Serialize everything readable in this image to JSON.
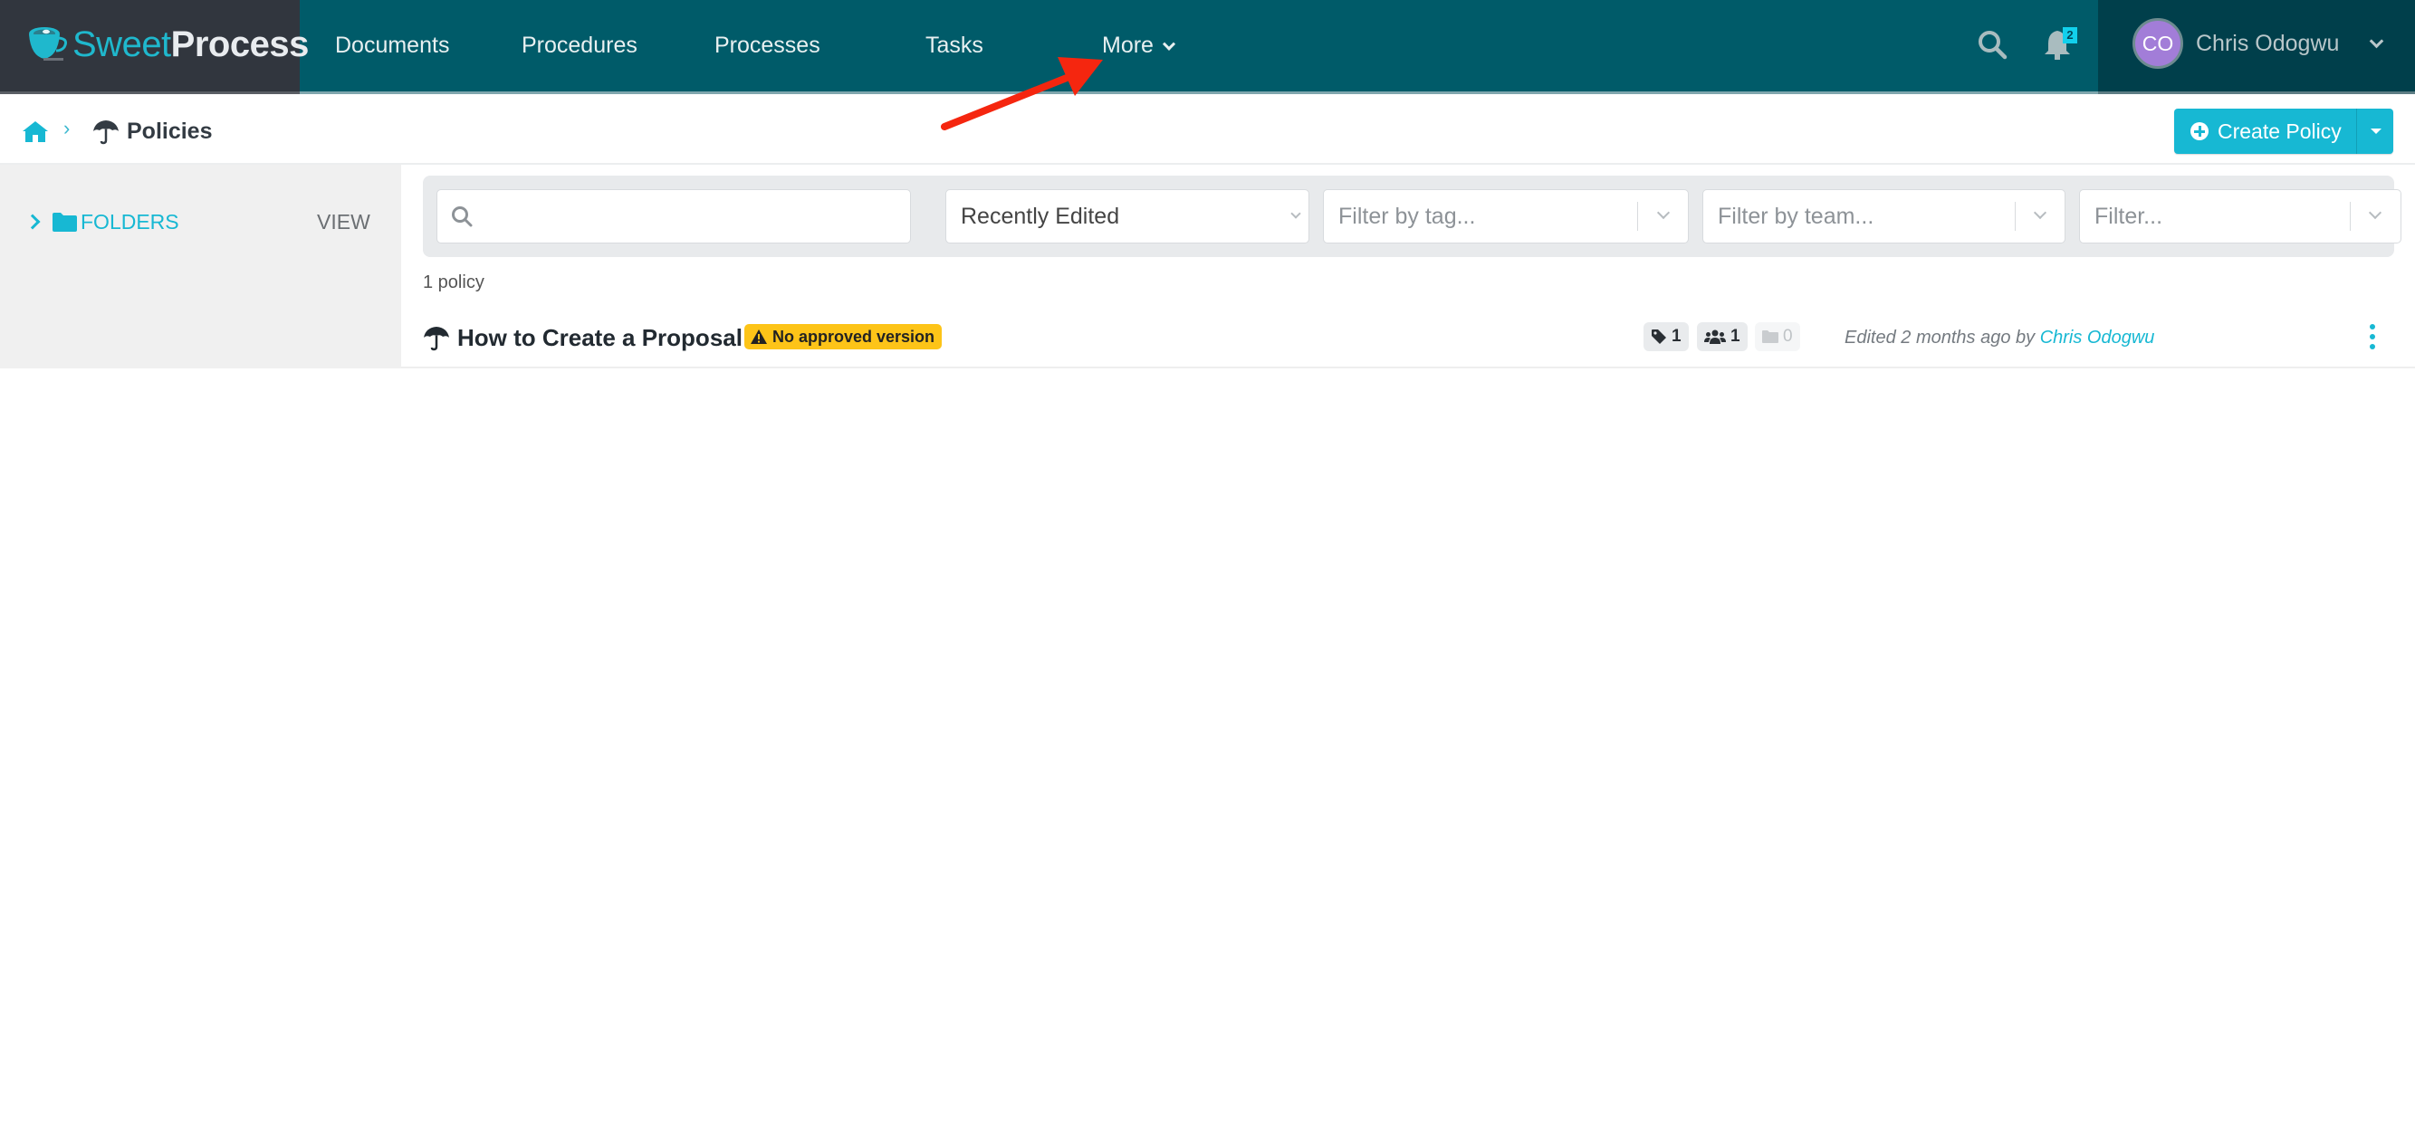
{
  "brand": {
    "name_part1": "Sweet",
    "name_part2": "Process",
    "icon": "coffee-cup-logo-icon"
  },
  "nav": {
    "items": [
      {
        "label": "Documents"
      },
      {
        "label": "Procedures"
      },
      {
        "label": "Processes"
      },
      {
        "label": "Tasks"
      },
      {
        "label": "More",
        "icon": "chevron-down-icon"
      }
    ],
    "search_icon": "search-icon",
    "notifications": {
      "icon": "bell-icon",
      "count": "2"
    },
    "user": {
      "initials": "CO",
      "name": "Chris Odogwu",
      "avatar_color": "#a27dd8"
    }
  },
  "breadcrumb": {
    "home_icon": "home-icon",
    "separator": "›",
    "current": {
      "icon": "umbrella-icon",
      "label": "Policies"
    }
  },
  "actions": {
    "create_label": "Create Policy",
    "create_icon": "plus-circle-icon",
    "dropdown_icon": "caret-down-icon"
  },
  "sidebar": {
    "folders_label": "FOLDERS",
    "view_label": "VIEW"
  },
  "filters": {
    "search": {
      "value": "",
      "placeholder": ""
    },
    "sort": {
      "selected": "Recently Edited"
    },
    "tag": {
      "placeholder": "Filter by tag..."
    },
    "team": {
      "placeholder": "Filter by team..."
    },
    "other": {
      "placeholder": "Filter..."
    }
  },
  "list": {
    "count_label": "1 policy",
    "items": [
      {
        "title": "How to Create a Proposal",
        "status_badge": "No approved version",
        "tags_count": "1",
        "teams_count": "1",
        "folders_count": "0",
        "edited_prefix": "Edited 2 months ago by",
        "edited_by": "Chris Odogwu"
      }
    ]
  },
  "annotation": {
    "type": "red-arrow",
    "points_to": "More",
    "color": "#f5260f"
  },
  "colors": {
    "nav_bg": "#005b69",
    "brand_bg": "#31363e",
    "user_bg": "#003f4b",
    "accent": "#17b8d3",
    "warning": "#fdc418"
  }
}
